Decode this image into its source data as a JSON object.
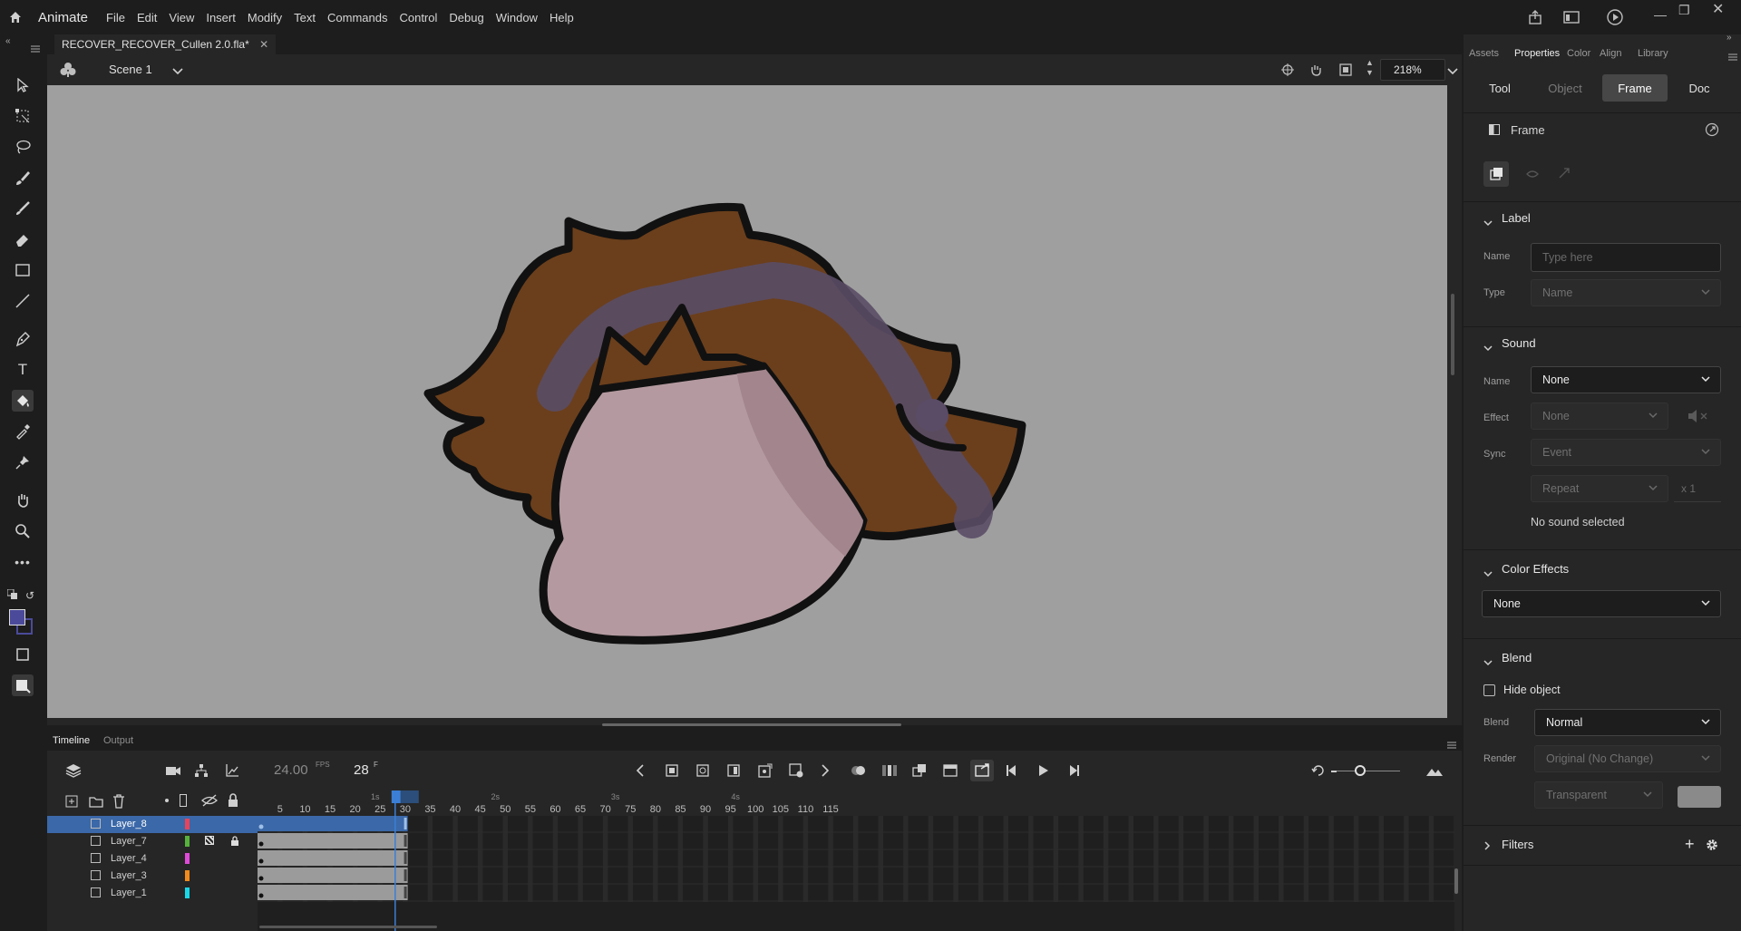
{
  "app": {
    "name": "Animate",
    "menu": [
      "File",
      "Edit",
      "View",
      "Insert",
      "Modify",
      "Text",
      "Commands",
      "Control",
      "Debug",
      "Window",
      "Help"
    ]
  },
  "document": {
    "tab_title": "RECOVER_RECOVER_Cullen 2.0.fla*",
    "scene": "Scene 1",
    "zoom": "218%"
  },
  "timeline": {
    "tabs": [
      "Timeline",
      "Output"
    ],
    "fps": "24.00",
    "fps_unit": "FPS",
    "frame": "28",
    "frame_unit": "F",
    "second_markers": [
      "1s",
      "2s",
      "3s",
      "4s"
    ],
    "frame_numbers": [
      "5",
      "10",
      "15",
      "20",
      "25",
      "30",
      "35",
      "40",
      "45",
      "50",
      "55",
      "60",
      "65",
      "70",
      "75",
      "80",
      "85",
      "90",
      "95",
      "100",
      "105",
      "110",
      "115"
    ],
    "playhead_frame": 28,
    "layers": [
      {
        "name": "Layer_8",
        "color": "#e8435a",
        "selected": true
      },
      {
        "name": "Layer_7",
        "color": "#56b23c",
        "selected": false
      },
      {
        "name": "Layer_4",
        "color": "#e04ad8",
        "selected": false
      },
      {
        "name": "Layer_3",
        "color": "#f28b1b",
        "selected": false
      },
      {
        "name": "Layer_1",
        "color": "#18d8e8",
        "selected": false
      }
    ]
  },
  "panel": {
    "tabs": [
      "Assets",
      "Properties",
      "Color",
      "Align",
      "Library"
    ],
    "active_tab": "Properties",
    "segments": [
      "Tool",
      "Object",
      "Frame",
      "Doc"
    ],
    "active_segment": "Frame",
    "header": "Frame",
    "label_section": {
      "title": "Label",
      "name_label": "Name",
      "name_placeholder": "Type here",
      "type_label": "Type",
      "type_value": "Name"
    },
    "sound_section": {
      "title": "Sound",
      "name_label": "Name",
      "name_value": "None",
      "effect_label": "Effect",
      "effect_value": "None",
      "sync_label": "Sync",
      "sync_value": "Event",
      "repeat_value": "Repeat",
      "repeat_count": "x 1",
      "status": "No sound selected"
    },
    "color_effects": {
      "title": "Color Effects",
      "value": "None"
    },
    "blend_section": {
      "title": "Blend",
      "hide_object": "Hide object",
      "blend_label": "Blend",
      "blend_value": "Normal",
      "render_label": "Render",
      "render_value": "Original (No Change)",
      "bg_value": "Transparent"
    },
    "filters": {
      "title": "Filters"
    }
  },
  "colors": {
    "stage": "#9f9f9f",
    "selection": "#3b68a8",
    "fill_swatch": "#4b4a9a"
  }
}
